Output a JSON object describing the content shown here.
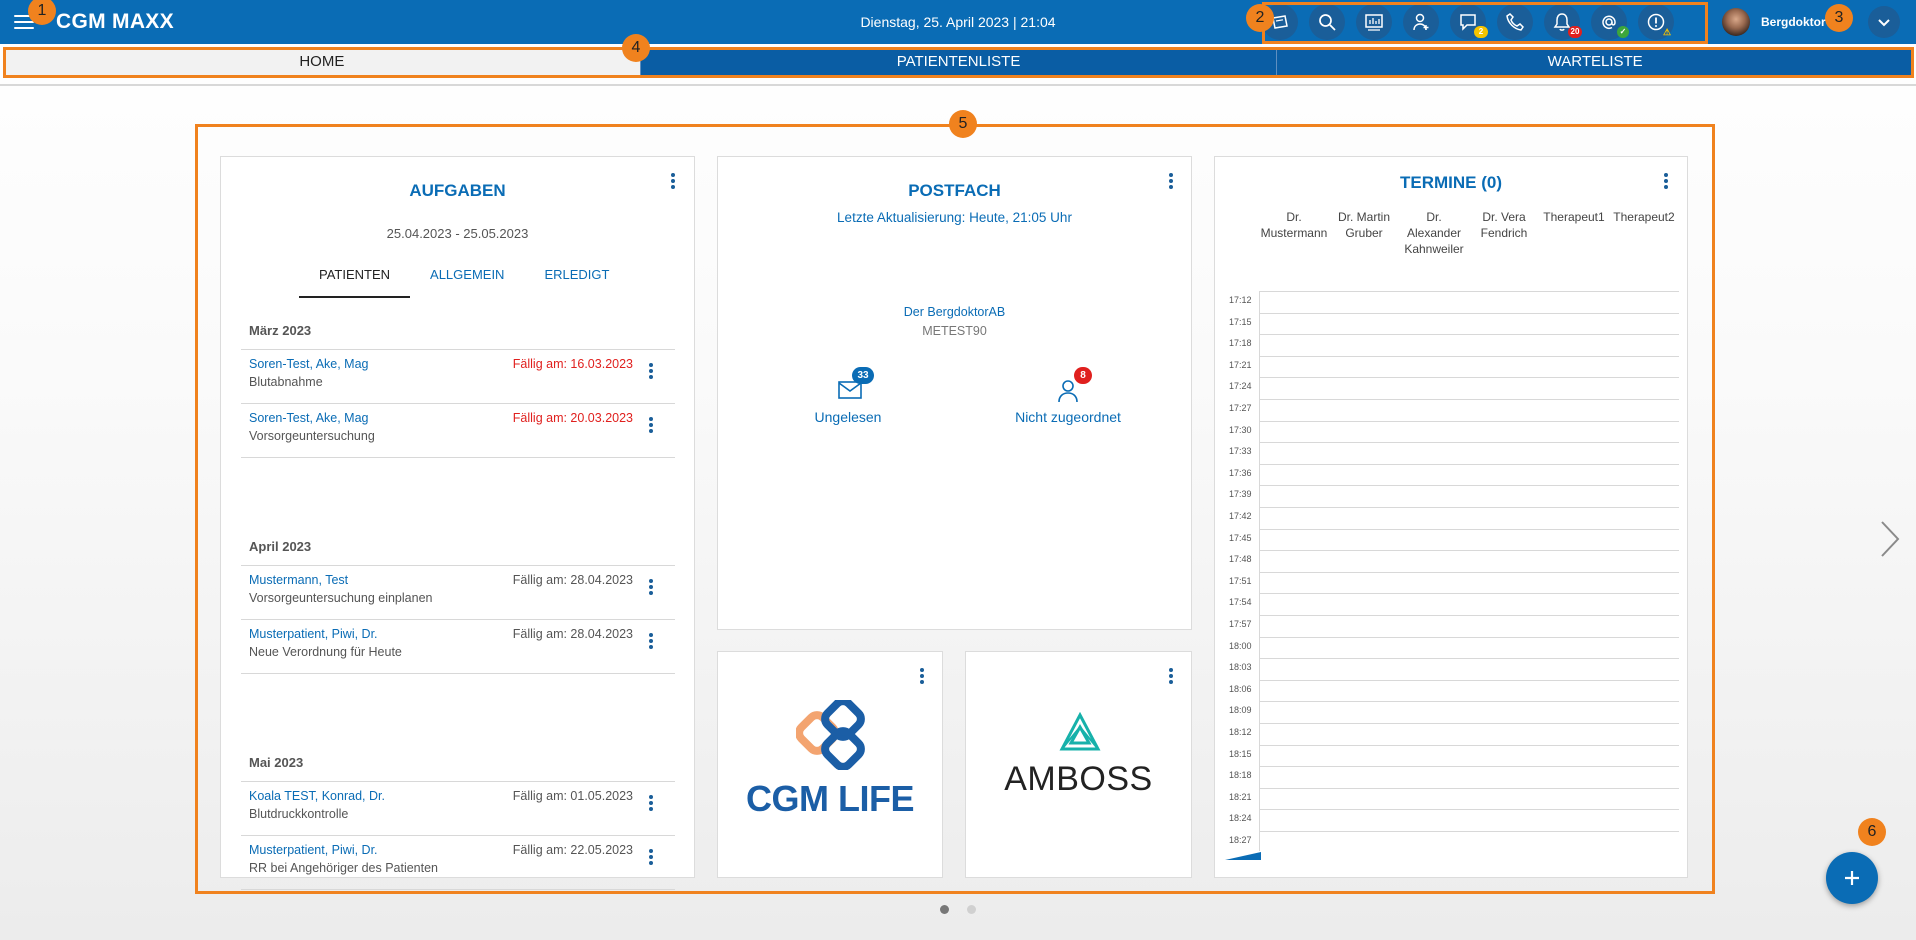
{
  "app": {
    "title": "CGM MAXX",
    "datetime": "Dienstag, 25. April 2023 | 21:04"
  },
  "header": {
    "icons": [
      {
        "name": "ticket-icon"
      },
      {
        "name": "search-icon"
      },
      {
        "name": "dashboard-icon"
      },
      {
        "name": "add-person-icon"
      },
      {
        "name": "chat-icon",
        "badge": "2",
        "badge_color": "#f5c400"
      },
      {
        "name": "phone-icon"
      },
      {
        "name": "bell-icon",
        "badge": "20",
        "badge_color": "#e0201e"
      },
      {
        "name": "at-sign-icon",
        "badge": "✓",
        "badge_color": "#3ca63c"
      },
      {
        "name": "info-icon",
        "badge": "⚠",
        "badge_color": "transparent"
      }
    ],
    "username": "Bergdoktor"
  },
  "tabs": [
    {
      "label": "HOME",
      "active": true
    },
    {
      "label": "PATIENTENLISTE",
      "active": false
    },
    {
      "label": "WARTELISTE",
      "active": false
    }
  ],
  "markers": [
    "1",
    "2",
    "3",
    "4",
    "5",
    "6"
  ],
  "aufgaben": {
    "title": "AUFGABEN",
    "range": "25.04.2023 - 25.05.2023",
    "tabs": [
      "PATIENTEN",
      "ALLGEMEIN",
      "ERLEDIGT"
    ],
    "groups": [
      {
        "label": "März  2023",
        "tasks": [
          {
            "name": "Soren-Test, Ake, Mag",
            "desc": "Blutabnahme",
            "due": "Fällig am: 16.03.2023",
            "overdue": true
          },
          {
            "name": "Soren-Test, Ake, Mag",
            "desc": "Vorsorgeuntersuchung",
            "due": "Fällig am: 20.03.2023",
            "overdue": true
          }
        ]
      },
      {
        "label": "April  2023",
        "tasks": [
          {
            "name": "Mustermann, Test",
            "desc": "Vorsorgeuntersuchung einplanen",
            "due": "Fällig am: 28.04.2023",
            "overdue": false
          },
          {
            "name": "Musterpatient, Piwi, Dr.",
            "desc": "Neue Verordnung für Heute",
            "due": "Fällig am: 28.04.2023",
            "overdue": false
          }
        ]
      },
      {
        "label": "Mai  2023",
        "tasks": [
          {
            "name": "Koala TEST, Konrad, Dr.",
            "desc": "Blutdruckkontrolle",
            "due": "Fällig am: 01.05.2023",
            "overdue": false
          },
          {
            "name": "Musterpatient, Piwi, Dr.",
            "desc": "RR bei Angehöriger des Patienten",
            "due": "Fällig am: 22.05.2023",
            "overdue": false
          }
        ]
      }
    ]
  },
  "postfach": {
    "title": "POSTFACH",
    "updated": "Letzte Aktualisierung: Heute, 21:05 Uhr",
    "account": "Der BergdoktorAB",
    "account_id": "METEST90",
    "unread_label": "Ungelesen",
    "unread_count": "33",
    "unassigned_label": "Nicht zugeordnet",
    "unassigned_count": "8"
  },
  "tiles": {
    "cgm_life": "CGM LIFE",
    "amboss": "AMBOSS"
  },
  "termine": {
    "title": "TERMINE (0)",
    "columns": [
      "Dr. Mustermann",
      "Dr. Martin Gruber",
      "Dr. Alexander Kahnweiler",
      "Dr. Vera Fendrich",
      "Therapeut1",
      "Therapeut2"
    ],
    "times": [
      "17:12",
      "17:15",
      "17:18",
      "17:21",
      "17:24",
      "17:27",
      "17:30",
      "17:33",
      "17:36",
      "17:39",
      "17:42",
      "17:45",
      "17:48",
      "17:51",
      "17:54",
      "17:57",
      "18:00",
      "18:03",
      "18:06",
      "18:09",
      "18:12",
      "18:15",
      "18:18",
      "18:21",
      "18:24",
      "18:27"
    ]
  },
  "colors": {
    "brand": "#0a6cb5",
    "annotation": "#f0821e",
    "overdue": "#e0201e"
  }
}
